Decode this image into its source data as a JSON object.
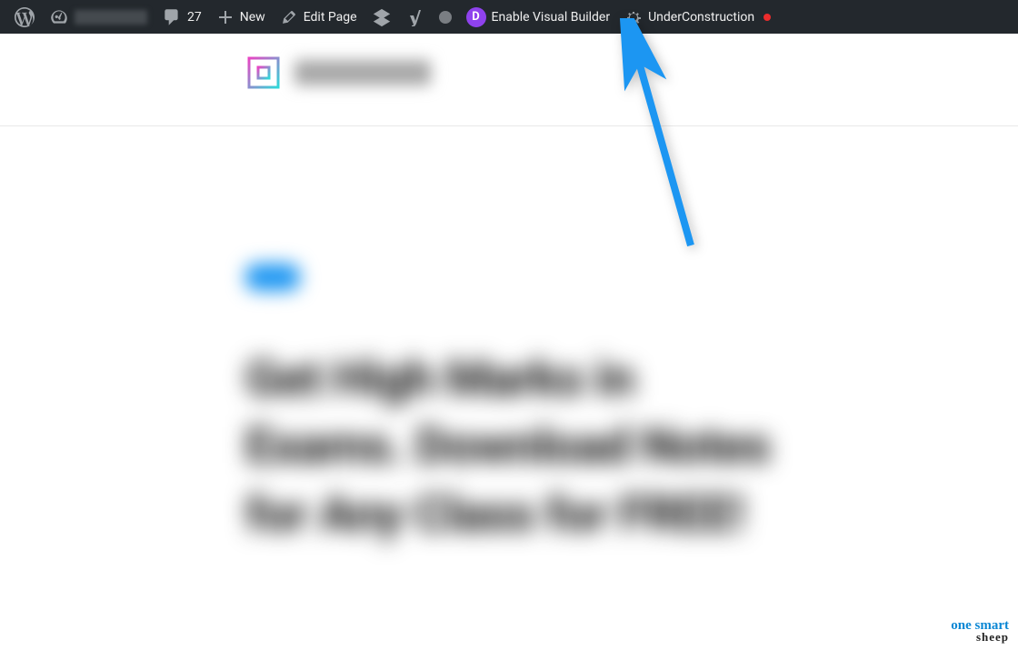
{
  "adminbar": {
    "comment_count": "27",
    "new_label": "New",
    "edit_page_label": "Edit Page",
    "enable_visual_builder_label": "Enable Visual Builder",
    "under_construction_label": "UnderConstruction",
    "divi_letter": "D"
  },
  "content": {
    "heading": "Get High Marks in Exams. Download Notes for Any Class for FREE!"
  },
  "watermark": {
    "line1": "one smart",
    "line2": "sheep"
  }
}
